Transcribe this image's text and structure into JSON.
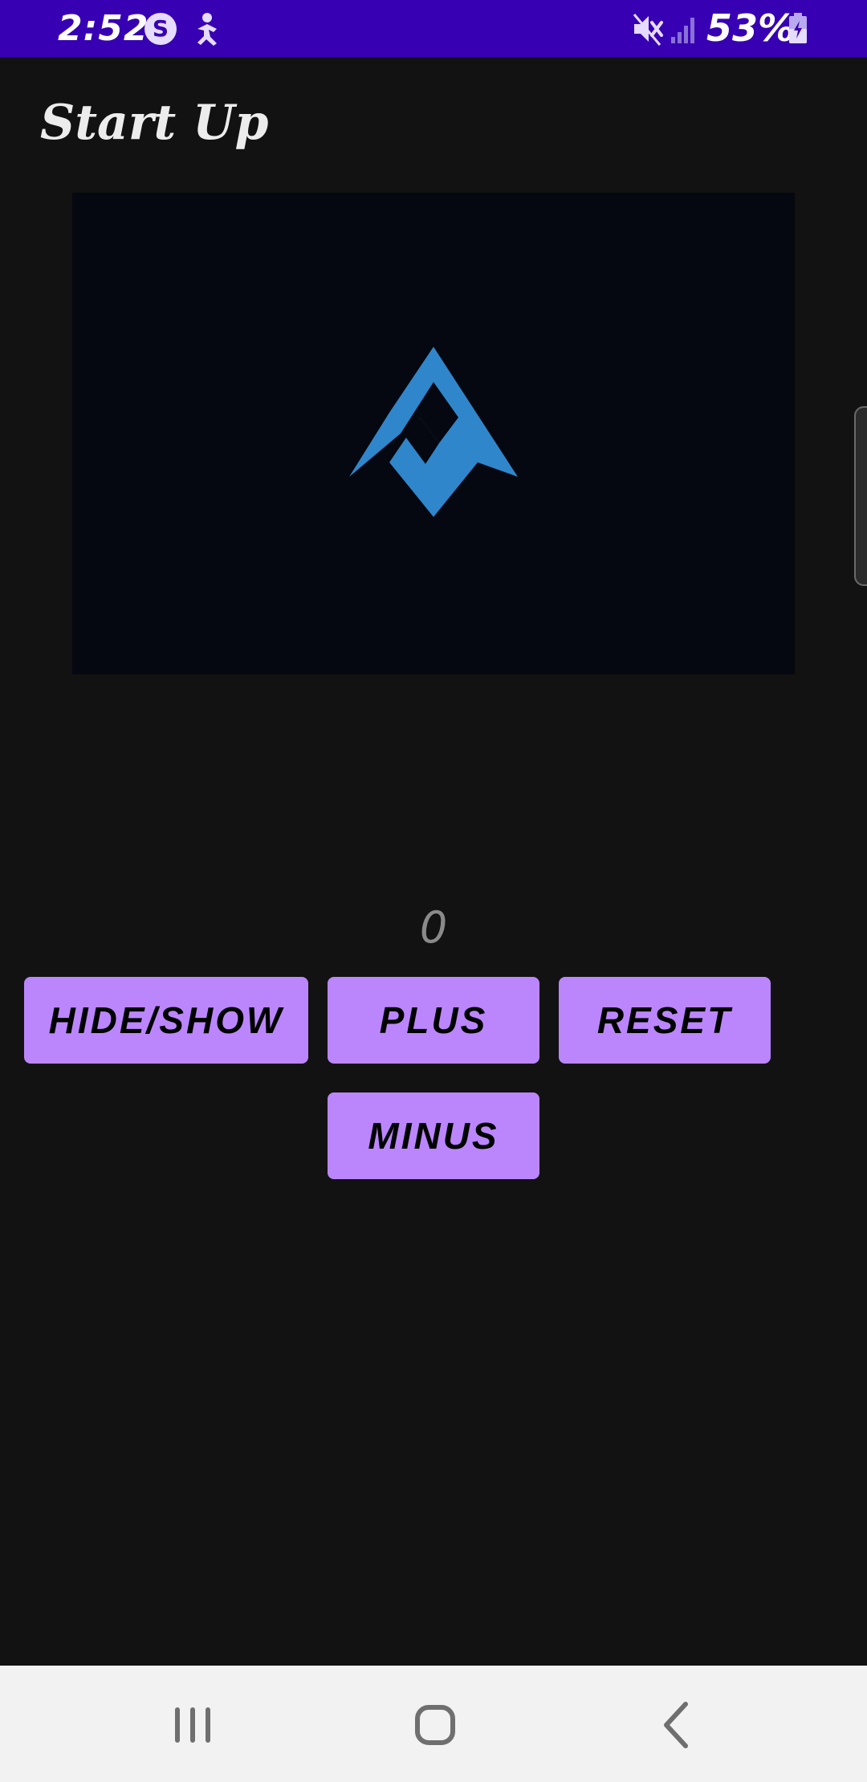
{
  "status_bar": {
    "time": "2:52",
    "battery_text": "53%",
    "icons": [
      "s-circle-icon",
      "figure-icon",
      "mute-icon",
      "signal-icon",
      "battery-icon"
    ],
    "color": "#3700B3"
  },
  "app_bar": {
    "title": "Start Up"
  },
  "logo": {
    "icon": "logo-icon",
    "color": "#2F86CB",
    "background": "#050810"
  },
  "counter": {
    "value": "0"
  },
  "buttons": {
    "hide_show": "HIDE/SHOW",
    "plus": "PLUS",
    "reset": "RESET",
    "minus": "MINUS",
    "color": "#BB86FC"
  },
  "nav_bar": {
    "icons": [
      "recent-apps-icon",
      "home-icon",
      "back-icon"
    ]
  }
}
